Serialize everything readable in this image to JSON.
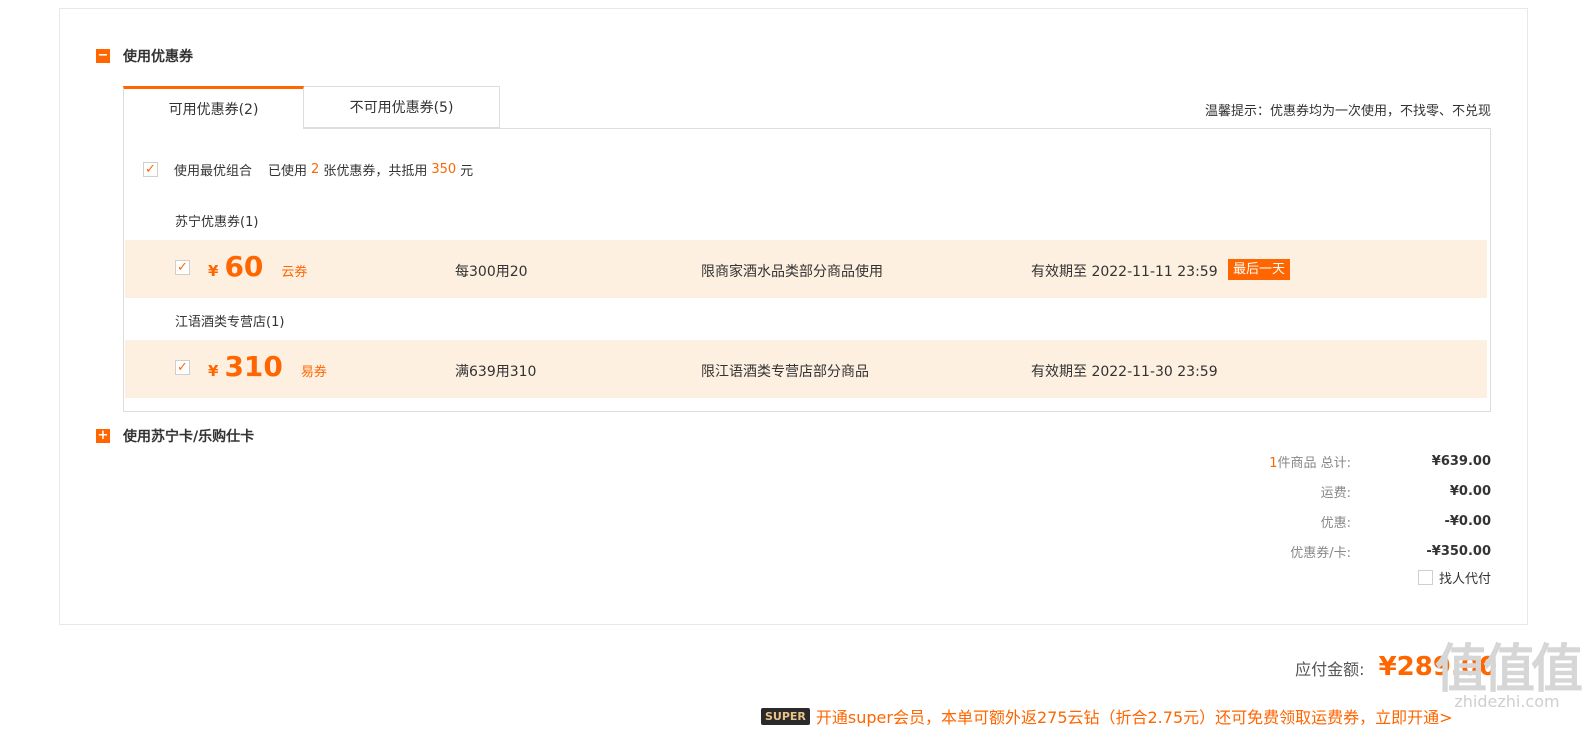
{
  "coupon_section": {
    "title": "使用优惠券",
    "toggle_icon": "minus-icon",
    "tabs": [
      {
        "label": "可用优惠券(2)",
        "active": true
      },
      {
        "label": "不可用优惠券(5)",
        "active": false
      }
    ],
    "tip": "温馨提示：优惠券均为一次使用，不找零、不兑现",
    "best_combo": {
      "checked": true,
      "label": "使用最优组合",
      "used_prefix": "已使用",
      "used_count": "2",
      "used_mid": "张优惠券，共抵用",
      "used_amount": "350",
      "used_suffix": "元"
    },
    "groups": [
      {
        "label": "苏宁优惠券(1)",
        "coupon": {
          "checked": true,
          "currency": "¥",
          "amount": "60",
          "type": "云券",
          "condition": "每300用20",
          "limit": "限商家酒水品类部分商品使用",
          "validity": "有效期至 2022-11-11 23:59",
          "badge": "最后一天"
        }
      },
      {
        "label": "江语酒类专营店(1)",
        "coupon": {
          "checked": true,
          "currency": "¥",
          "amount": "310",
          "type": "易券",
          "condition": "满639用310",
          "limit": "限江语酒类专营店部分商品",
          "validity": "有效期至 2022-11-30 23:59"
        }
      }
    ]
  },
  "card_section": {
    "title": "使用苏宁卡/乐购仕卡",
    "toggle_icon": "plus-icon"
  },
  "summary": {
    "items_count": "1",
    "items_label": "件商品 总计:",
    "items_total": "¥639.00",
    "shipping_label": "运费:",
    "shipping": "¥0.00",
    "discount_label": "优惠:",
    "discount": "-¥0.00",
    "coupon_label": "优惠券/卡:",
    "coupon": "-¥350.00",
    "pay_for_other": "找人代付"
  },
  "total": {
    "label": "应付金额:",
    "value": "¥289.00"
  },
  "promo": {
    "badge": "SUPER",
    "text": "开通super会员，本单可额外返275云钻（折合2.75元）还可免费领取运费券，立即开通>"
  },
  "watermark": {
    "mark": "值值值",
    "site": "zhidezhi.com"
  },
  "colors": {
    "accent": "#ff6600",
    "coupon_row_bg": "#fdf0e0",
    "border": "#dddddd"
  }
}
